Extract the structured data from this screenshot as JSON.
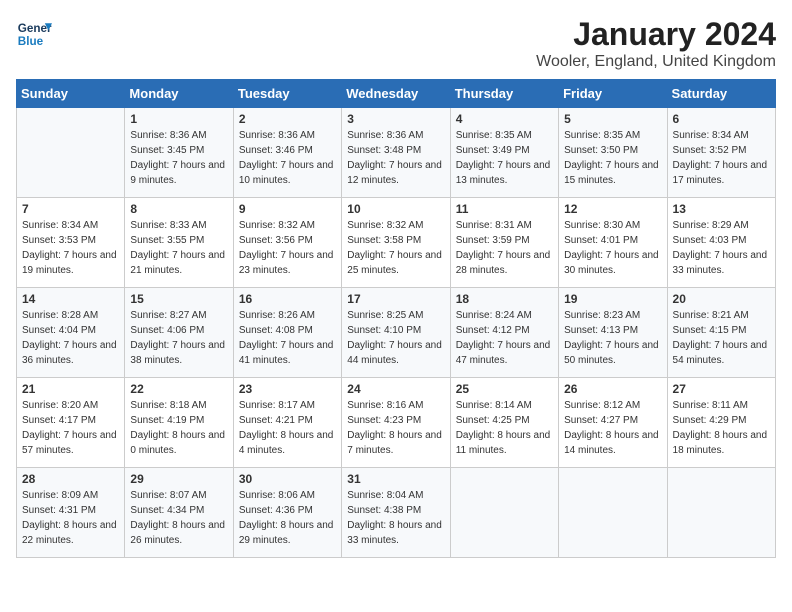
{
  "header": {
    "logo_line1": "General",
    "logo_line2": "Blue",
    "month_title": "January 2024",
    "location": "Wooler, England, United Kingdom"
  },
  "days_of_week": [
    "Sunday",
    "Monday",
    "Tuesday",
    "Wednesday",
    "Thursday",
    "Friday",
    "Saturday"
  ],
  "weeks": [
    [
      {
        "day": "",
        "sunrise": "",
        "sunset": "",
        "daylight": ""
      },
      {
        "day": "1",
        "sunrise": "Sunrise: 8:36 AM",
        "sunset": "Sunset: 3:45 PM",
        "daylight": "Daylight: 7 hours and 9 minutes."
      },
      {
        "day": "2",
        "sunrise": "Sunrise: 8:36 AM",
        "sunset": "Sunset: 3:46 PM",
        "daylight": "Daylight: 7 hours and 10 minutes."
      },
      {
        "day": "3",
        "sunrise": "Sunrise: 8:36 AM",
        "sunset": "Sunset: 3:48 PM",
        "daylight": "Daylight: 7 hours and 12 minutes."
      },
      {
        "day": "4",
        "sunrise": "Sunrise: 8:35 AM",
        "sunset": "Sunset: 3:49 PM",
        "daylight": "Daylight: 7 hours and 13 minutes."
      },
      {
        "day": "5",
        "sunrise": "Sunrise: 8:35 AM",
        "sunset": "Sunset: 3:50 PM",
        "daylight": "Daylight: 7 hours and 15 minutes."
      },
      {
        "day": "6",
        "sunrise": "Sunrise: 8:34 AM",
        "sunset": "Sunset: 3:52 PM",
        "daylight": "Daylight: 7 hours and 17 minutes."
      }
    ],
    [
      {
        "day": "7",
        "sunrise": "Sunrise: 8:34 AM",
        "sunset": "Sunset: 3:53 PM",
        "daylight": "Daylight: 7 hours and 19 minutes."
      },
      {
        "day": "8",
        "sunrise": "Sunrise: 8:33 AM",
        "sunset": "Sunset: 3:55 PM",
        "daylight": "Daylight: 7 hours and 21 minutes."
      },
      {
        "day": "9",
        "sunrise": "Sunrise: 8:32 AM",
        "sunset": "Sunset: 3:56 PM",
        "daylight": "Daylight: 7 hours and 23 minutes."
      },
      {
        "day": "10",
        "sunrise": "Sunrise: 8:32 AM",
        "sunset": "Sunset: 3:58 PM",
        "daylight": "Daylight: 7 hours and 25 minutes."
      },
      {
        "day": "11",
        "sunrise": "Sunrise: 8:31 AM",
        "sunset": "Sunset: 3:59 PM",
        "daylight": "Daylight: 7 hours and 28 minutes."
      },
      {
        "day": "12",
        "sunrise": "Sunrise: 8:30 AM",
        "sunset": "Sunset: 4:01 PM",
        "daylight": "Daylight: 7 hours and 30 minutes."
      },
      {
        "day": "13",
        "sunrise": "Sunrise: 8:29 AM",
        "sunset": "Sunset: 4:03 PM",
        "daylight": "Daylight: 7 hours and 33 minutes."
      }
    ],
    [
      {
        "day": "14",
        "sunrise": "Sunrise: 8:28 AM",
        "sunset": "Sunset: 4:04 PM",
        "daylight": "Daylight: 7 hours and 36 minutes."
      },
      {
        "day": "15",
        "sunrise": "Sunrise: 8:27 AM",
        "sunset": "Sunset: 4:06 PM",
        "daylight": "Daylight: 7 hours and 38 minutes."
      },
      {
        "day": "16",
        "sunrise": "Sunrise: 8:26 AM",
        "sunset": "Sunset: 4:08 PM",
        "daylight": "Daylight: 7 hours and 41 minutes."
      },
      {
        "day": "17",
        "sunrise": "Sunrise: 8:25 AM",
        "sunset": "Sunset: 4:10 PM",
        "daylight": "Daylight: 7 hours and 44 minutes."
      },
      {
        "day": "18",
        "sunrise": "Sunrise: 8:24 AM",
        "sunset": "Sunset: 4:12 PM",
        "daylight": "Daylight: 7 hours and 47 minutes."
      },
      {
        "day": "19",
        "sunrise": "Sunrise: 8:23 AM",
        "sunset": "Sunset: 4:13 PM",
        "daylight": "Daylight: 7 hours and 50 minutes."
      },
      {
        "day": "20",
        "sunrise": "Sunrise: 8:21 AM",
        "sunset": "Sunset: 4:15 PM",
        "daylight": "Daylight: 7 hours and 54 minutes."
      }
    ],
    [
      {
        "day": "21",
        "sunrise": "Sunrise: 8:20 AM",
        "sunset": "Sunset: 4:17 PM",
        "daylight": "Daylight: 7 hours and 57 minutes."
      },
      {
        "day": "22",
        "sunrise": "Sunrise: 8:18 AM",
        "sunset": "Sunset: 4:19 PM",
        "daylight": "Daylight: 8 hours and 0 minutes."
      },
      {
        "day": "23",
        "sunrise": "Sunrise: 8:17 AM",
        "sunset": "Sunset: 4:21 PM",
        "daylight": "Daylight: 8 hours and 4 minutes."
      },
      {
        "day": "24",
        "sunrise": "Sunrise: 8:16 AM",
        "sunset": "Sunset: 4:23 PM",
        "daylight": "Daylight: 8 hours and 7 minutes."
      },
      {
        "day": "25",
        "sunrise": "Sunrise: 8:14 AM",
        "sunset": "Sunset: 4:25 PM",
        "daylight": "Daylight: 8 hours and 11 minutes."
      },
      {
        "day": "26",
        "sunrise": "Sunrise: 8:12 AM",
        "sunset": "Sunset: 4:27 PM",
        "daylight": "Daylight: 8 hours and 14 minutes."
      },
      {
        "day": "27",
        "sunrise": "Sunrise: 8:11 AM",
        "sunset": "Sunset: 4:29 PM",
        "daylight": "Daylight: 8 hours and 18 minutes."
      }
    ],
    [
      {
        "day": "28",
        "sunrise": "Sunrise: 8:09 AM",
        "sunset": "Sunset: 4:31 PM",
        "daylight": "Daylight: 8 hours and 22 minutes."
      },
      {
        "day": "29",
        "sunrise": "Sunrise: 8:07 AM",
        "sunset": "Sunset: 4:34 PM",
        "daylight": "Daylight: 8 hours and 26 minutes."
      },
      {
        "day": "30",
        "sunrise": "Sunrise: 8:06 AM",
        "sunset": "Sunset: 4:36 PM",
        "daylight": "Daylight: 8 hours and 29 minutes."
      },
      {
        "day": "31",
        "sunrise": "Sunrise: 8:04 AM",
        "sunset": "Sunset: 4:38 PM",
        "daylight": "Daylight: 8 hours and 33 minutes."
      },
      {
        "day": "",
        "sunrise": "",
        "sunset": "",
        "daylight": ""
      },
      {
        "day": "",
        "sunrise": "",
        "sunset": "",
        "daylight": ""
      },
      {
        "day": "",
        "sunrise": "",
        "sunset": "",
        "daylight": ""
      }
    ]
  ]
}
